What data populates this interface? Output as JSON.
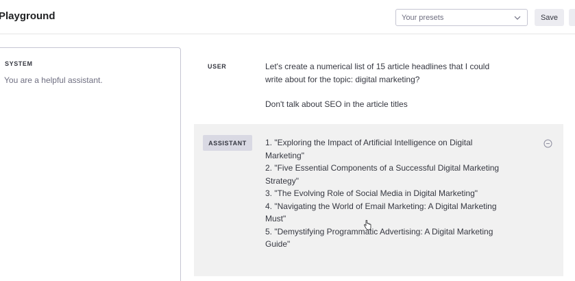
{
  "header": {
    "title": "Playground",
    "presets_placeholder": "Your presets",
    "save_label": "Save"
  },
  "system": {
    "label": "SYSTEM",
    "text": "You are a helpful assistant."
  },
  "messages": {
    "user": {
      "role": "USER",
      "line1": "Let's create a numerical list of 15 article headlines that I could",
      "line2": "write about for the topic: digital marketing?",
      "line3": "Don't talk about SEO in the article titles"
    },
    "assistant": {
      "role": "ASSISTANT",
      "lines": [
        "1. \"Exploring the Impact of Artificial Intelligence on Digital",
        "Marketing\"",
        "2. \"Five Essential Components of a Successful Digital Marketing",
        "Strategy\"",
        "3. \"The Evolving Role of Social Media in Digital Marketing\"",
        "4. \"Navigating the World of Email Marketing: A Digital Marketing",
        "Must\"",
        "5. \"Demystifying Programmatic Advertising: A Digital Marketing",
        "Guide\""
      ]
    }
  },
  "icons": {
    "chevron": "chevron-down-icon",
    "remove": "minus-circle-icon",
    "cursor": "hand-pointer-icon"
  }
}
